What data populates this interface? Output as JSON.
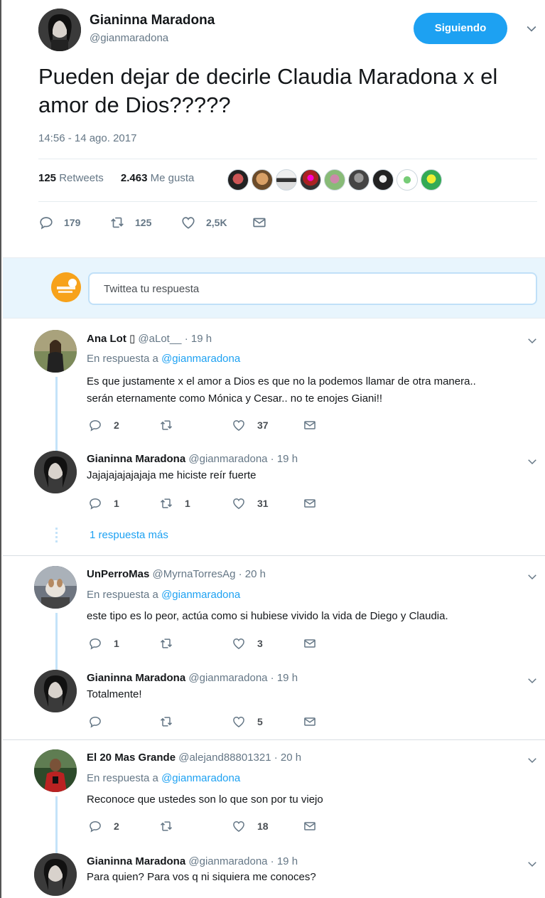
{
  "main_tweet": {
    "author_name": "Gianinna Maradona",
    "author_handle": "@gianmaradona",
    "follow_label": "Siguiendo",
    "text": "Pueden dejar de decirle Claudia Maradona x el amor de Dios?????",
    "timestamp": "14:56 - 14 ago. 2017",
    "retweets_count": "125",
    "retweets_label": "Retweets",
    "likes_count": "2.463",
    "likes_label": "Me gusta",
    "actions": {
      "replies": "179",
      "retweets": "125",
      "likes": "2,5K"
    }
  },
  "reply_box": {
    "placeholder": "Twittea tu respuesta"
  },
  "in_reply_prefix": "En respuesta a",
  "in_reply_target": "@gianmaradona",
  "more_replies_label": "1 respuesta más",
  "threads": [
    {
      "reply": {
        "name": "Ana Lot ▯",
        "handle": "@aLot__ · 19 h",
        "text_line1": "Es que justamente x el amor a Dios es que no la podemos llamar de otra manera..",
        "text_line2": "serán eternamente como Mónica y Cesar.. no te enojes Giani!!",
        "replies": "2",
        "retweets": "",
        "likes": "37"
      },
      "answer": {
        "name": "Gianinna Maradona",
        "handle": "@gianmaradona · 19 h",
        "text": "Jajajajajajajaja me hiciste reír fuerte",
        "replies": "1",
        "retweets": "1",
        "likes": "31"
      }
    },
    {
      "reply": {
        "name": "UnPerroMas",
        "handle": "@MyrnaTorresAg · 20 h",
        "text": "este tipo es lo peor, actúa como si hubiese vivido la vida de Diego y Claudia.",
        "replies": "1",
        "retweets": "",
        "likes": "3"
      },
      "answer": {
        "name": "Gianinna Maradona",
        "handle": "@gianmaradona · 19 h",
        "text": "Totalmente!",
        "replies": "",
        "retweets": "",
        "likes": "5"
      }
    },
    {
      "reply": {
        "name": "El 20 Mas Grande",
        "handle": "@alejand88801321 · 20 h",
        "text": "Reconoce que ustedes son lo que son por tu viejo",
        "replies": "2",
        "retweets": "",
        "likes": "18"
      },
      "answer": {
        "name": "Gianinna Maradona",
        "handle": "@gianmaradona · 19 h",
        "text": "Para quien? Para vos q ni siquiera me conoces?"
      }
    }
  ],
  "colors": {
    "accent": "#1da1f2",
    "muted": "#657786",
    "reply_bg": "#e8f5fd",
    "thread_line": "#c4e3f9"
  }
}
